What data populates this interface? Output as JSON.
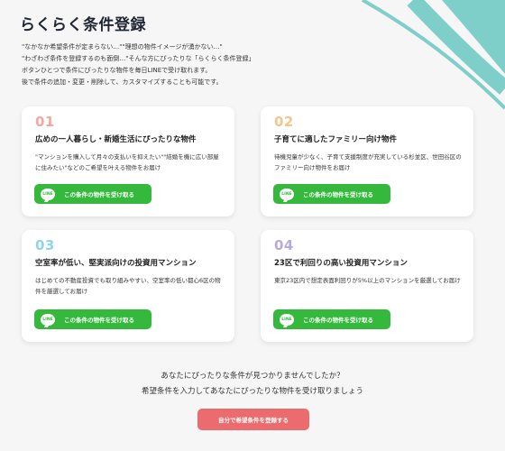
{
  "page": {
    "title": "らくらく条件登録",
    "intro": [
      "\"なかなか希望条件が定まらない…\"\"理想の物件イメージが湧かない…\"",
      "\"わざわざ条件を登録するのも面倒…\"そんな方にぴったりな「らくらく条件登録」",
      "ボタンひとつで条件にぴったりな物件を毎日LINEで受け取れます。",
      "後で条件の追加・変更・削除して、カスタマイズすることも可能です。"
    ]
  },
  "colors": {
    "num1": "#f2a7a0",
    "num2": "#f6c58f",
    "num3": "#8fd6e6",
    "num4": "#b7a8e0",
    "line_green": "#34b93d",
    "cta": "#ec6b6e",
    "deco_teal": "#7ecfca"
  },
  "line_icon_text": "LINE",
  "cards": [
    {
      "num": "01",
      "title": "広めの一人暮らし・新婚生活にぴったりな物件",
      "desc": "\"マンションを購入して月々の支払いを抑えたい\"\"結婚を機に広い部屋に住みたい\"などのご希望を叶える物件をお届け",
      "button": "この条件の物件を受け取る"
    },
    {
      "num": "02",
      "title": "子育てに適したファミリー向け物件",
      "desc": "待機児童が少なく、子育て支援制度が充実している杉並区、世田谷区のファミリー向け物件をお届け",
      "button": "この条件の物件を受け取る"
    },
    {
      "num": "03",
      "title": "空室率が低い、堅実派向けの投資用マンション",
      "desc": "はじめての不動産投資でも取り組みやすい、空室率の低い都心6区の物件を厳選してお届け",
      "button": "この条件の物件を受け取る"
    },
    {
      "num": "04",
      "title": "23区で利回りの高い投資用マンション",
      "desc": "東京23区内で想定表面利回りが5%以上のマンションを厳選してお届け",
      "button": "この条件の物件を受け取る"
    }
  ],
  "footer": {
    "line1": "あなたにぴったりな条件が見つかりませんでしたか？",
    "line2": "希望条件を入力してあなたにぴったりな物件を受け取りましょう",
    "cta": "自分で希望条件を登録する"
  }
}
